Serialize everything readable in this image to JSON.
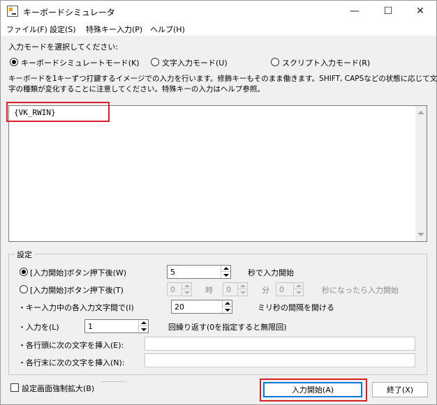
{
  "window": {
    "title": "キーボードシミュレータ",
    "controls": {
      "minimize": "—",
      "maximize": "☐",
      "close": "✕"
    }
  },
  "menu": [
    "ファイル(F)",
    "設定(S)",
    "特殊キー入力(P)",
    "ヘルプ(H)"
  ],
  "mode": {
    "prompt": "入力モードを選択してください:",
    "options": [
      "キーボードシミュレートモード(K)",
      "文字入力モード(U)",
      "スクリプト入力モード(R)"
    ],
    "selected": 0
  },
  "description": [
    "キーボードを1キーずつ打鍵するイメージでの入力を行います。修飾キーもそのまま働きます。SHIFT, CAPSなどの状態に応じて文",
    "字の種類が変化することに注意してください。特殊キーの入力はヘルプ参照。"
  ],
  "input_text": "{VK_RWIN}",
  "settings": {
    "group_title": "設定",
    "row1": {
      "label": "[入力開始]ボタン押下後(W)",
      "value": "5",
      "suffix": "秒で入力開始",
      "checked": true
    },
    "row2": {
      "label": "[入力開始]ボタン押下後(T)",
      "hour": "0",
      "hour_label": "時",
      "minute": "0",
      "minute_label": "分",
      "second": "0",
      "suffix": "秒になったら入力開始",
      "checked": false
    },
    "interval": {
      "label": "・キー入力中の各入力文字間で(I)",
      "value": "20",
      "suffix": "ミリ秒の間隔を開ける"
    },
    "repeat": {
      "label": "・入力を(L)",
      "value": "1",
      "suffix": "回繰り返す(0を指定すると無限回)"
    },
    "prefix": {
      "label": "・各行頭に次の文字を挿入(E):",
      "value": ""
    },
    "postfix": {
      "label": "・各行末に次の文字を挿入(N):",
      "value": ""
    }
  },
  "footer": {
    "expand_label": "設定画面強制拡大(B)",
    "expand_checked": false,
    "start_button": "入力開始(A)",
    "exit_button": "終了(X)"
  },
  "accent_colors": {
    "highlight": "#d62026",
    "focus": "#0078d7"
  }
}
